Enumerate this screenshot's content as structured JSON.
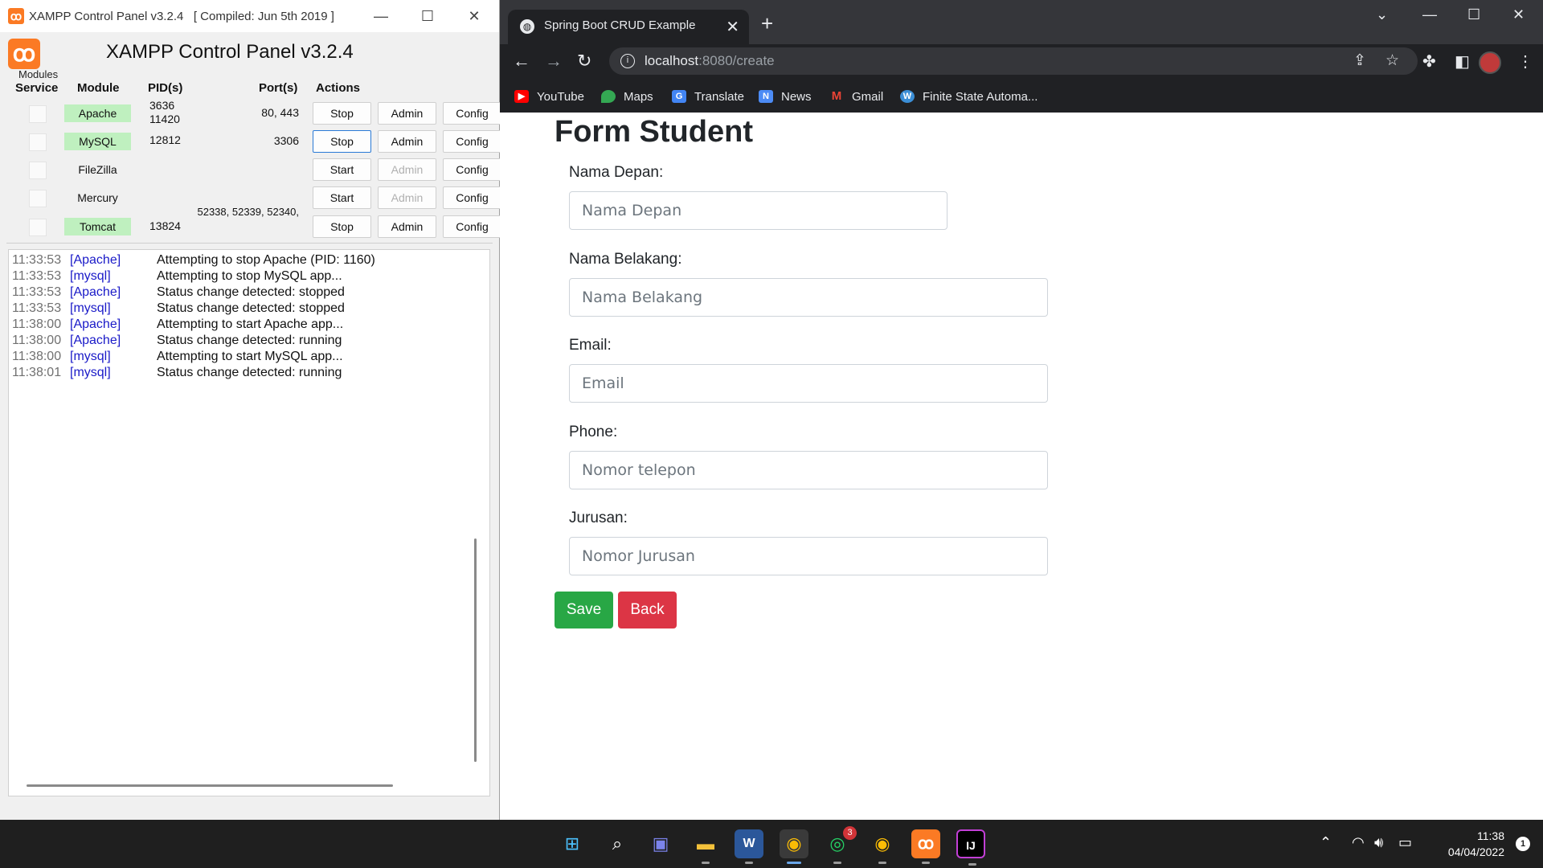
{
  "xampp": {
    "window_title": "XAMPP Control Panel v3.2.4   [ Compiled: Jun 5th 2019 ]",
    "logo_glyph": "ꝏ",
    "header_title": "XAMPP Control Panel v3.2.4",
    "modules_label": "Modules",
    "columns": {
      "service": "Service",
      "module": "Module",
      "pids": "PID(s)",
      "ports": "Port(s)",
      "actions": "Actions"
    },
    "modules": [
      {
        "name": "Apache",
        "pid1": "3636",
        "pid2": "11420",
        "port": "80, 443",
        "action": "Stop",
        "admin": "Admin",
        "config": "Config",
        "running": true
      },
      {
        "name": "MySQL",
        "pid1": "12812",
        "pid2": "",
        "port": "3306",
        "action": "Stop",
        "admin": "Admin",
        "config": "Config",
        "running": true
      },
      {
        "name": "FileZilla",
        "pid1": "",
        "pid2": "",
        "port": "",
        "action": "Start",
        "admin": "Admin",
        "config": "Config",
        "running": false
      },
      {
        "name": "Mercury",
        "pid1": "",
        "pid2": "",
        "port": "52338, 52339, 52340,",
        "action": "Start",
        "admin": "Admin",
        "config": "Config",
        "running": false
      },
      {
        "name": "Tomcat",
        "pid1": "13824",
        "pid2": "",
        "port": "",
        "action": "Stop",
        "admin": "Admin",
        "config": "Config",
        "running": true
      }
    ],
    "log": [
      {
        "time": "11:33:53",
        "module": "[Apache]",
        "msg": "Attempting to stop Apache (PID: 1160)"
      },
      {
        "time": "11:33:53",
        "module": "[mysql]",
        "msg": "Attempting to stop MySQL app..."
      },
      {
        "time": "11:33:53",
        "module": "[Apache]",
        "msg": "Status change detected: stopped"
      },
      {
        "time": "11:33:53",
        "module": "[mysql]",
        "msg": "Status change detected: stopped"
      },
      {
        "time": "11:38:00",
        "module": "[Apache]",
        "msg": "Attempting to start Apache app..."
      },
      {
        "time": "11:38:00",
        "module": "[Apache]",
        "msg": "Status change detected: running"
      },
      {
        "time": "11:38:00",
        "module": "[mysql]",
        "msg": "Attempting to start MySQL app..."
      },
      {
        "time": "11:38:01",
        "module": "[mysql]",
        "msg": "Status change detected: running"
      }
    ]
  },
  "browser": {
    "tab_title": "Spring Boot CRUD Example",
    "url_host": "localhost",
    "url_path": ":8080/create",
    "bookmarks": [
      {
        "label": "YouTube",
        "icon": "youtube-icon",
        "color": "#ff0000"
      },
      {
        "label": "Maps",
        "icon": "maps-icon",
        "color": "#34a853"
      },
      {
        "label": "Translate",
        "icon": "translate-icon",
        "color": "#4285f4"
      },
      {
        "label": "News",
        "icon": "news-icon",
        "color": "#4c8bf5"
      },
      {
        "label": "Gmail",
        "icon": "gmail-icon",
        "color": "#ea4335"
      },
      {
        "label": "Finite State Automa...",
        "icon": "wordpress-icon",
        "color": "#3b8ed6"
      }
    ]
  },
  "form": {
    "title": "Form Student",
    "fields": [
      {
        "label": "Nama Depan:",
        "placeholder": "Nama Depan"
      },
      {
        "label": "Nama Belakang:",
        "placeholder": "Nama Belakang"
      },
      {
        "label": "Email:",
        "placeholder": "Email"
      },
      {
        "label": "Phone:",
        "placeholder": "Nomor telepon"
      },
      {
        "label": "Jurusan:",
        "placeholder": "Nomor Jurusan"
      }
    ],
    "save_label": "Save",
    "back_label": "Back",
    "colors": {
      "save": "#28a745",
      "back": "#dc3545"
    }
  },
  "taskbar": {
    "whatsapp_badge": "3",
    "time": "11:38",
    "date": "04/04/2022",
    "notification_count": "1"
  }
}
